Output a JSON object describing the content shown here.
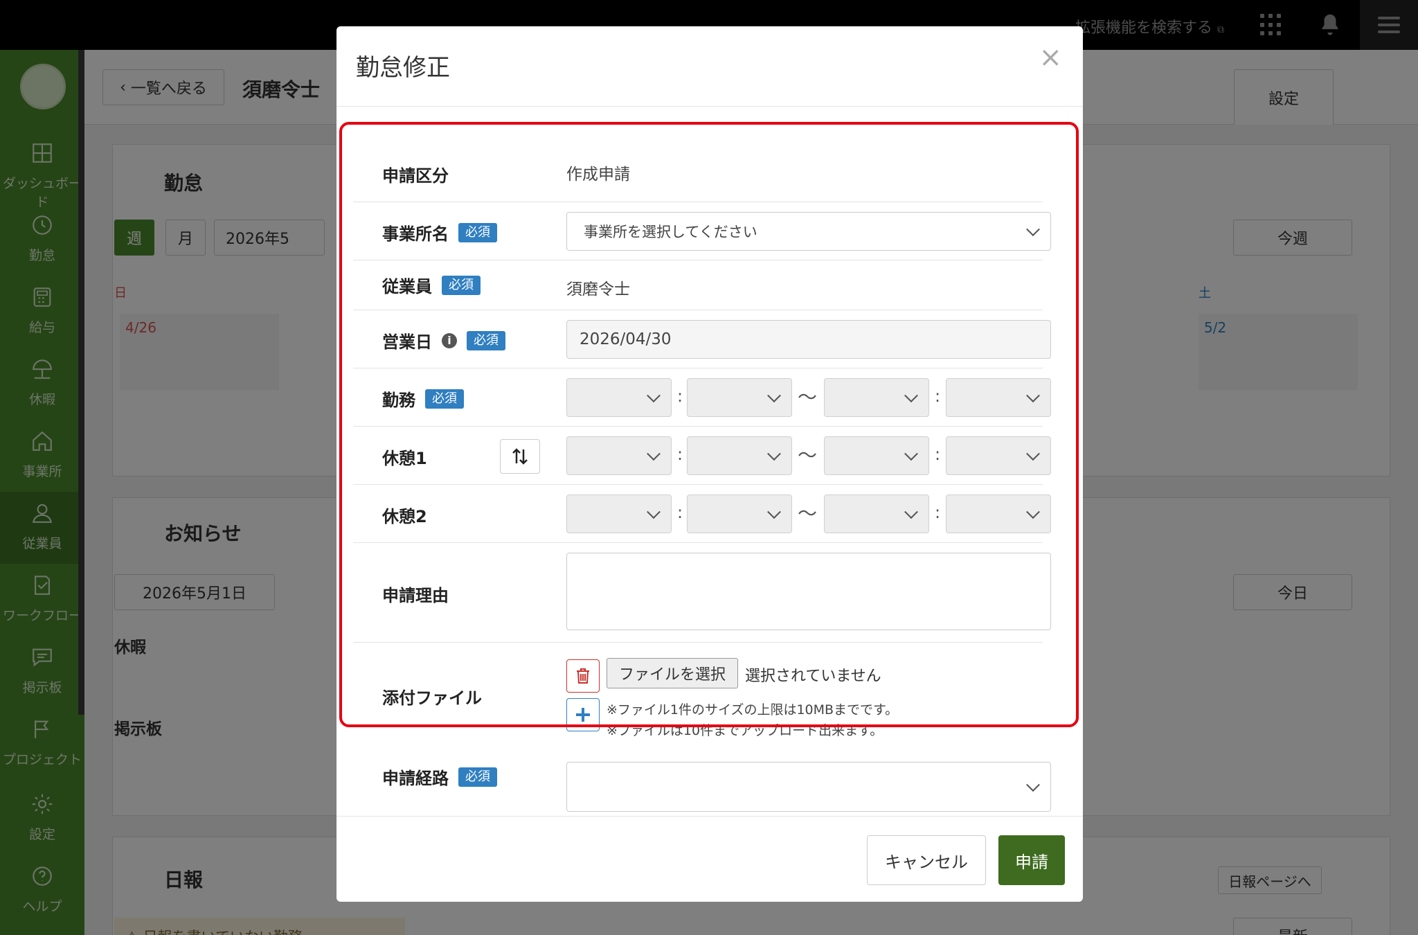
{
  "topbar": {
    "extension_search": "拡張機能を検索する"
  },
  "sidebar": {
    "items": [
      {
        "label": "ダッシュボード",
        "icon": "dashboard-icon"
      },
      {
        "label": "勤怠",
        "icon": "clock-icon"
      },
      {
        "label": "給与",
        "icon": "calculator-icon"
      },
      {
        "label": "休暇",
        "icon": "umbrella-icon"
      },
      {
        "label": "事業所",
        "icon": "home-icon"
      },
      {
        "label": "従業員",
        "icon": "person-icon"
      },
      {
        "label": "ワークフロー",
        "icon": "workflow-icon"
      },
      {
        "label": "掲示板",
        "icon": "message-icon"
      },
      {
        "label": "プロジェクト",
        "icon": "flag-icon"
      },
      {
        "label": "設定",
        "icon": "gear-icon"
      },
      {
        "label": "ヘルプ",
        "icon": "help-icon"
      }
    ],
    "active_index": 5
  },
  "page": {
    "back_label": "一覧へ戻る",
    "employee_name": "須磨令士",
    "settings_tab": "設定",
    "attendance_title": "勤怠",
    "week_button": "週",
    "month_button": "月",
    "date_picker_week": "2026年5",
    "this_week_button": "今週",
    "day_sun": "日",
    "day_sat": "土",
    "date_sun": "4/26",
    "date_sat": "5/2",
    "notices_title": "お知らせ",
    "notice_date": "2026年5月1日",
    "today_button": "今日",
    "vacation_label": "休暇",
    "board_label": "掲示板",
    "daily_report_title": "日報",
    "daily_report_page": "日報ページへ",
    "daily_report_warning": "日報を書いていない勤務",
    "latest_button": "最新"
  },
  "modal": {
    "title": "勤怠修正",
    "close": "×",
    "fields": {
      "application_type_label": "申請区分",
      "application_type_value": "作成申請",
      "office_label": "事業所名",
      "office_placeholder": "事業所を選択してください",
      "employee_label": "従業員",
      "employee_value": "須磨令士",
      "business_day_label": "営業日",
      "business_day_value": "2026/04/30",
      "work_label": "勤務",
      "break1_label": "休憩1",
      "break2_label": "休憩2",
      "reason_label": "申請理由",
      "attachment_label": "添付ファイル",
      "choose_file": "ファイルを選択",
      "no_file": "選択されていません",
      "note1": "※ファイル1件のサイズの上限は10MBまでです。",
      "note2": "※ファイルは10件までアップロード出来ます。",
      "route_label": "申請経路"
    },
    "required_badge": "必須",
    "time_separator": ":",
    "range_separator": "〜",
    "cancel": "キャンセル",
    "submit": "申請"
  },
  "colors": {
    "brand_green": "#4d8a2c",
    "submit_green": "#3e6b1f",
    "required_blue": "#2f7fc1",
    "highlight_red": "#e60012"
  }
}
